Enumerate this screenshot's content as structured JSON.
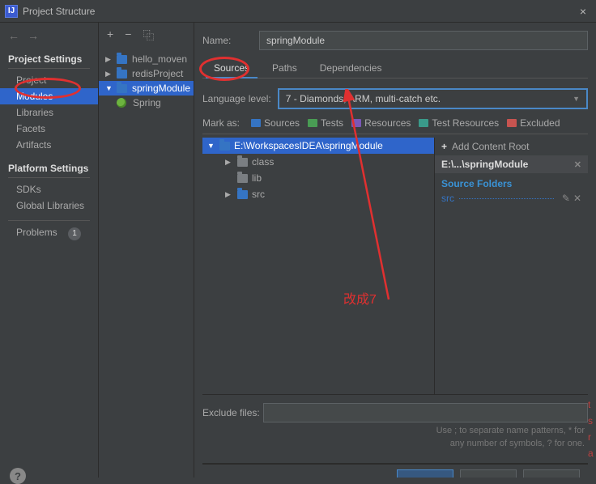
{
  "titlebar": {
    "title": "Project Structure",
    "close": "×"
  },
  "nav": {
    "arrows": {
      "back": "←",
      "fwd": "→"
    },
    "project_settings_heading": "Project Settings",
    "platform_settings_heading": "Platform Settings",
    "items": {
      "project": "Project",
      "modules": "Modules",
      "libraries": "Libraries",
      "facets": "Facets",
      "artifacts": "Artifacts",
      "sdks": "SDKs",
      "global_libraries": "Global Libraries",
      "problems": "Problems"
    },
    "problems_count": "1"
  },
  "toolbar": {
    "add": "+",
    "remove": "−",
    "copy": "⿻"
  },
  "modules": {
    "items": [
      {
        "name": "hello_moven"
      },
      {
        "name": "redisProject"
      },
      {
        "name": "springModule"
      }
    ],
    "spring_facet": "Spring"
  },
  "main": {
    "name_label": "Name:",
    "name_value": "springModule",
    "tabs": {
      "sources": "Sources",
      "paths": "Paths",
      "dependencies": "Dependencies"
    },
    "lang_label": "Language level:",
    "lang_value": "7 - Diamonds, ARM, multi-catch etc.",
    "markas_label": "Mark as:",
    "mark": {
      "sources": "Sources",
      "tests": "Tests",
      "resources": "Resources",
      "test_resources": "Test Resources",
      "excluded": "Excluded"
    },
    "tree": {
      "root": "E:\\WorkspacesIDEA\\springModule",
      "children": [
        "class",
        "lib",
        "src"
      ]
    },
    "right": {
      "add_root": "Add Content Root",
      "root_path": "E:\\...\\springModule",
      "source_folders": "Source Folders",
      "src": "src"
    },
    "exclude": {
      "label": "Exclude files:",
      "hint1": "Use ; to separate name patterns, * for",
      "hint2": "any number of symbols, ? for one."
    }
  },
  "annotation": {
    "text": "改成7"
  },
  "edge": {
    "c1": "t",
    "c2": "s",
    "c3": "r",
    "c4": "a"
  }
}
